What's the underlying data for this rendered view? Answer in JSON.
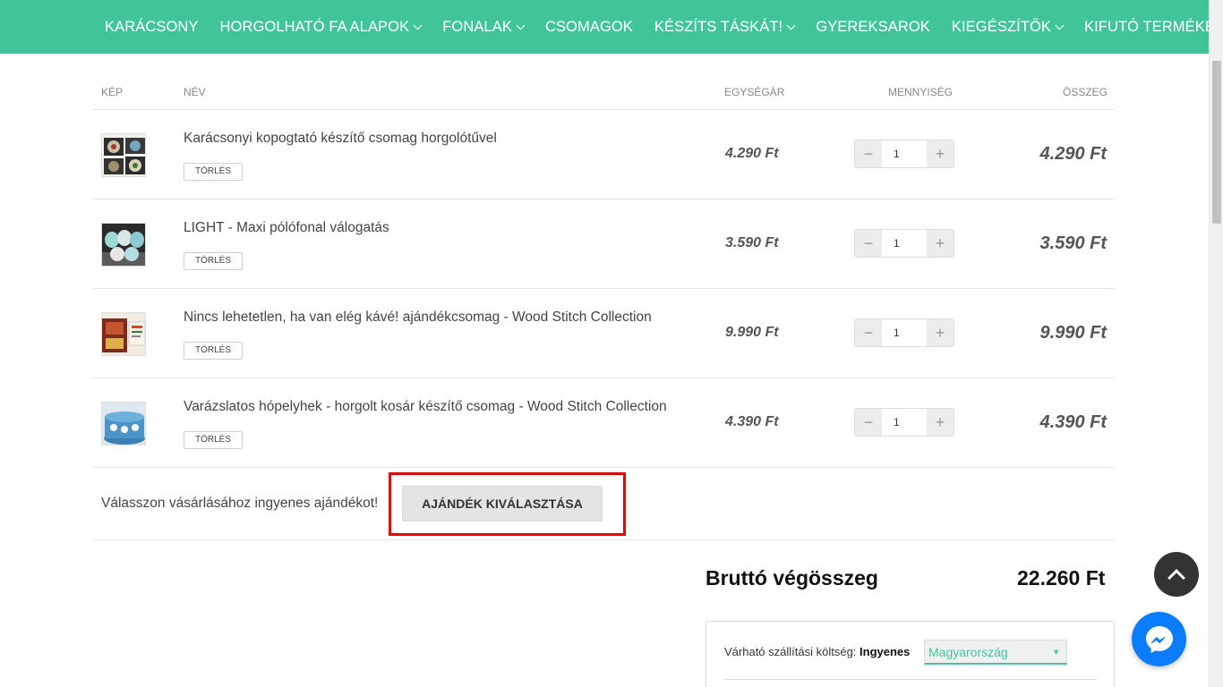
{
  "nav": {
    "items": [
      {
        "label": "KARÁCSONY",
        "dropdown": false
      },
      {
        "label": "HORGOLHATÓ FA ALAPOK",
        "dropdown": true
      },
      {
        "label": "FONALAK",
        "dropdown": true
      },
      {
        "label": "CSOMAGOK",
        "dropdown": false
      },
      {
        "label": "KÉSZÍTS TÁSKÁT!",
        "dropdown": true
      },
      {
        "label": "GYEREKSAROK",
        "dropdown": false
      },
      {
        "label": "KIEGÉSZÍTŐK",
        "dropdown": true
      },
      {
        "label": "KIFUTÓ TERMÉKEK",
        "dropdown": false
      }
    ]
  },
  "cart": {
    "headers": {
      "image": "KÉP",
      "name": "NÉV",
      "unit_price": "EGYSÉGÁR",
      "quantity": "MENNYISÉG",
      "total": "ÖSSZEG"
    },
    "delete_label": "TÖRLÉS",
    "items": [
      {
        "name": "Karácsonyi kopogtató készítő csomag horgolótűvel",
        "unit_price": "4.290 Ft",
        "quantity": "1",
        "total": "4.290 Ft"
      },
      {
        "name": "LIGHT - Maxi pólófonal válogatás",
        "unit_price": "3.590 Ft",
        "quantity": "1",
        "total": "3.590 Ft"
      },
      {
        "name": "Nincs lehetetlen, ha van elég kávé! ajándékcsomag - Wood Stitch Collection",
        "unit_price": "9.990 Ft",
        "quantity": "1",
        "total": "9.990 Ft"
      },
      {
        "name": "Varázslatos hópelyhek - horgolt kosár készítő csomag - Wood Stitch Collection",
        "unit_price": "4.390 Ft",
        "quantity": "1",
        "total": "4.390 Ft"
      }
    ],
    "gift": {
      "text": "Válasszon vásárlásához ingyenes ajándékot!",
      "button": "AJÁNDÉK KIVÁLASZTÁSA"
    }
  },
  "totals": {
    "label": "Bruttó végösszeg",
    "value": "22.260 Ft"
  },
  "shipping": {
    "label": "Várható szállítási költség:",
    "value": "Ingyenes",
    "country": "Magyarország"
  },
  "icons": {
    "minus": "minus-icon",
    "plus": "plus-icon",
    "chevron": "chevron-down-icon",
    "scroll_top": "chevron-up-icon",
    "messenger": "messenger-icon"
  },
  "colors": {
    "brand": "#42c49b",
    "highlight": "#e30000",
    "messenger": "#0a7cff"
  }
}
